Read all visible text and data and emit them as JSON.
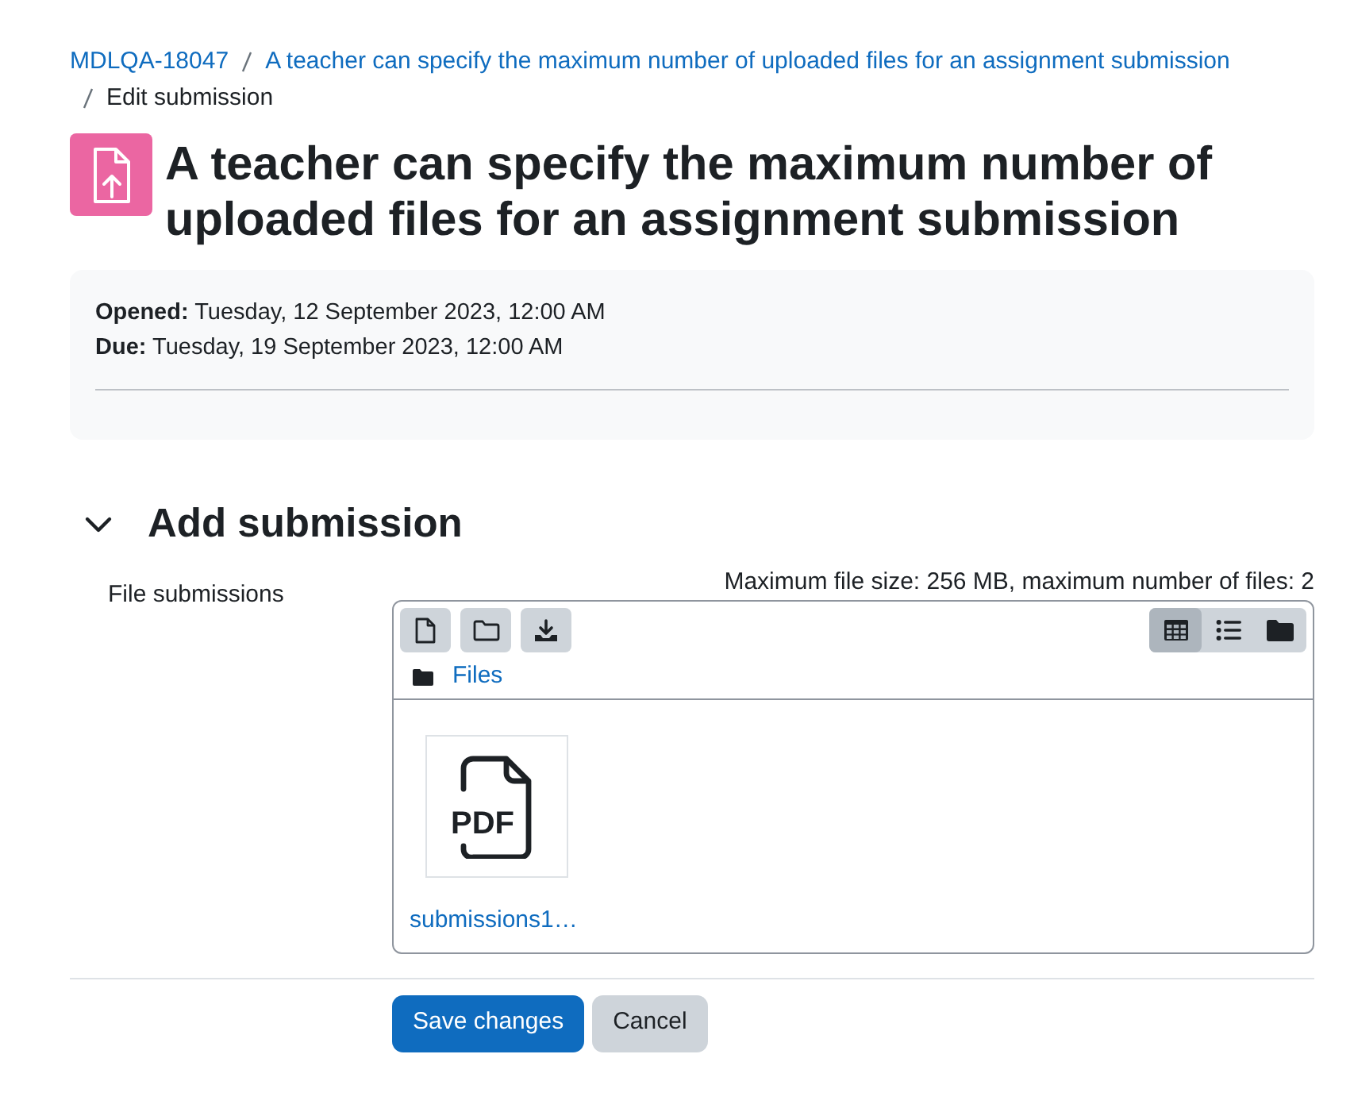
{
  "breadcrumb": [
    {
      "label": "MDLQA-18047",
      "kind": "link"
    },
    {
      "label": "A teacher can specify the maximum number of uploaded files for an assignment submission",
      "kind": "link"
    },
    {
      "label": "Edit submission",
      "kind": "current"
    }
  ],
  "page_title": "A teacher can specify the maximum number of uploaded files for an assignment submission",
  "dates": [
    "**Opened:** Tuesday, 12 September 2023, 12:00 AM",
    "**Due:** Tuesday, 19 September 2023, 12:00 AM"
  ],
  "section": {
    "title": "Add submission",
    "expanded": true
  },
  "file_submissions": {
    "label": "File submissions",
    "limits": "Maximum file size: 256 MB, maximum number of files: 2",
    "view_modes": [
      {
        "kind": "grid",
        "selected": true
      },
      {
        "kind": "list",
        "selected": false
      },
      {
        "kind": "tree",
        "selected": false
      }
    ],
    "path": "Files",
    "files": [
      {
        "name": "submissions1…",
        "kind": "pdf",
        "icon_label": "PDF"
      }
    ]
  },
  "buttons": [
    {
      "label": "Save changes",
      "kind": "primary"
    },
    {
      "label": "Cancel",
      "kind": "secondary"
    }
  ]
}
